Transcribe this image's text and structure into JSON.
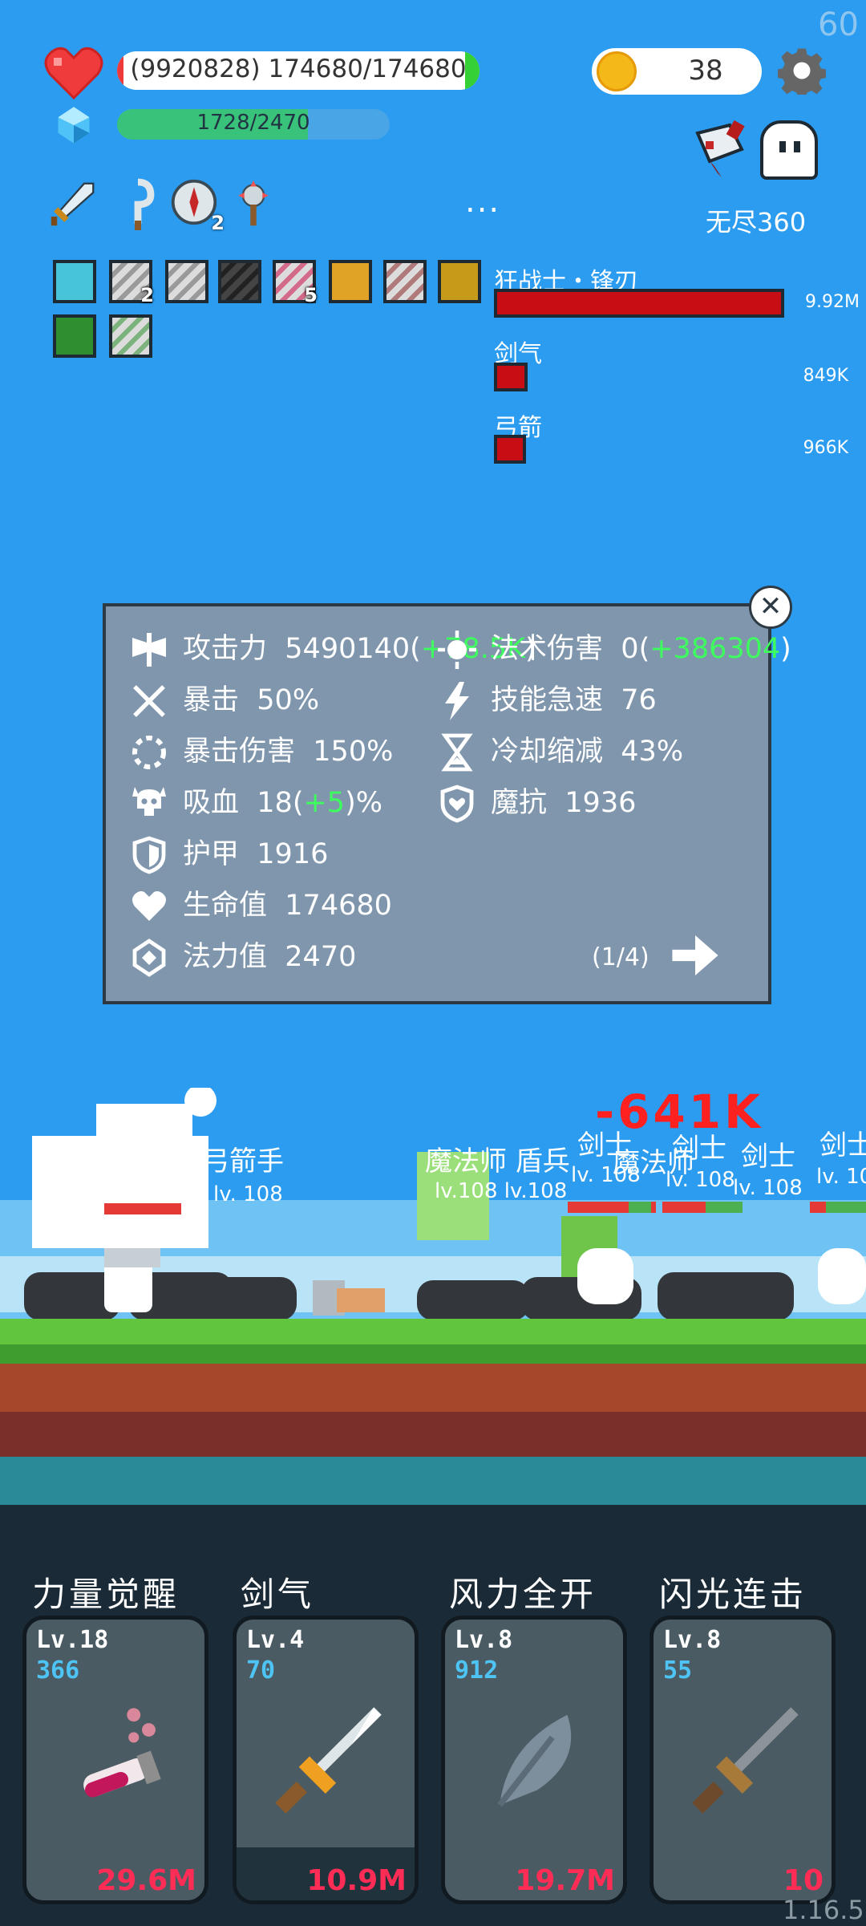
{
  "fps": "60",
  "player": {
    "hp_text": "(9920828) 174680/174680",
    "hp_fraction": 0.96,
    "mp_text": "1728/2470",
    "mp_fraction": 0.7
  },
  "coins": "38",
  "mode": "无尽360",
  "more": "...",
  "top_items": [
    {
      "icon": "sword-icon",
      "count": ""
    },
    {
      "icon": "hook-icon",
      "count": ""
    },
    {
      "icon": "compass-icon",
      "count": "2"
    },
    {
      "icon": "mace-icon",
      "count": ""
    }
  ],
  "buffs": [
    {
      "icon": "light-buff-icon",
      "count": ""
    },
    {
      "icon": "blade-buff-icon",
      "count": "2"
    },
    {
      "icon": "blade-buff-icon",
      "count": ""
    },
    {
      "icon": "dark-blade-buff-icon",
      "count": ""
    },
    {
      "icon": "blade-buff-icon",
      "count": "5"
    },
    {
      "icon": "armor-buff-icon",
      "count": ""
    },
    {
      "icon": "blade-buff-icon",
      "count": ""
    },
    {
      "icon": "skull-buff-icon",
      "count": ""
    },
    {
      "icon": "run-buff-icon",
      "count": ""
    },
    {
      "icon": "blade-buff-icon",
      "count": ""
    }
  ],
  "damage_sources": [
    {
      "name": "狂战士・锋刃",
      "value": "9.92M"
    },
    {
      "name": "剑气",
      "value": "849K"
    },
    {
      "name": "弓箭",
      "value": "966K"
    }
  ],
  "stats": {
    "attack": {
      "label": "攻击力",
      "value": "5490140",
      "bonus": "+78.5K"
    },
    "magic_damage": {
      "label": "法术伤害",
      "value": "0",
      "bonus": "+386304"
    },
    "crit": {
      "label": "暴击",
      "value": "50%"
    },
    "haste": {
      "label": "技能急速",
      "value": "76"
    },
    "crit_damage": {
      "label": "暴击伤害",
      "value": "150%"
    },
    "cooldown": {
      "label": "冷却缩减",
      "value": "43%"
    },
    "lifesteal": {
      "label": "吸血",
      "value": "18",
      "bonus": "+5",
      "unit": "%"
    },
    "magic_resist": {
      "label": "魔抗",
      "value": "1936"
    },
    "armor": {
      "label": "护甲",
      "value": "1916"
    },
    "health": {
      "label": "生命值",
      "value": "174680"
    },
    "mana": {
      "label": "法力值",
      "value": "2470"
    },
    "page": "(1/4)"
  },
  "battle": {
    "damage_popup": "-641K",
    "labels": [
      {
        "name": "弓箭手",
        "lv": ""
      },
      {
        "name": "弓箭手",
        "lv": "lv. 108"
      },
      {
        "name": "魔法师 盾兵",
        "lv": "lv.108 lv.108"
      },
      {
        "name": "魔法师",
        "lv": "lv. 108"
      },
      {
        "name": "剑士",
        "lv": "lv. 108"
      },
      {
        "name": "剑士",
        "lv": "lv. 108"
      },
      {
        "name": "剑士",
        "lv": "lv. 108"
      },
      {
        "name": "剑士",
        "lv": "lv. 10"
      }
    ]
  },
  "skills": [
    {
      "title": "力量觉醒",
      "level": "Lv.18",
      "cost": "366",
      "damage": "29.6M",
      "icon": "potion-icon"
    },
    {
      "title": "剑气",
      "level": "Lv.4",
      "cost": "70",
      "damage": "10.9M",
      "icon": "sword-icon"
    },
    {
      "title": "风力全开",
      "level": "Lv.8",
      "cost": "912",
      "damage": "19.7M",
      "icon": "feather-icon"
    },
    {
      "title": "闪光连击",
      "level": "Lv.8",
      "cost": "55",
      "damage": "10",
      "icon": "dagger-icon"
    }
  ],
  "version": "1.16.5",
  "colors": {
    "sky": "#2b9cf0",
    "hp_fill": "#35d035",
    "mp_fill": "#38c27a",
    "damage_bar": "#c80e14",
    "skill_damage": "#ff2d55",
    "skill_cost": "#4ec4f5"
  }
}
